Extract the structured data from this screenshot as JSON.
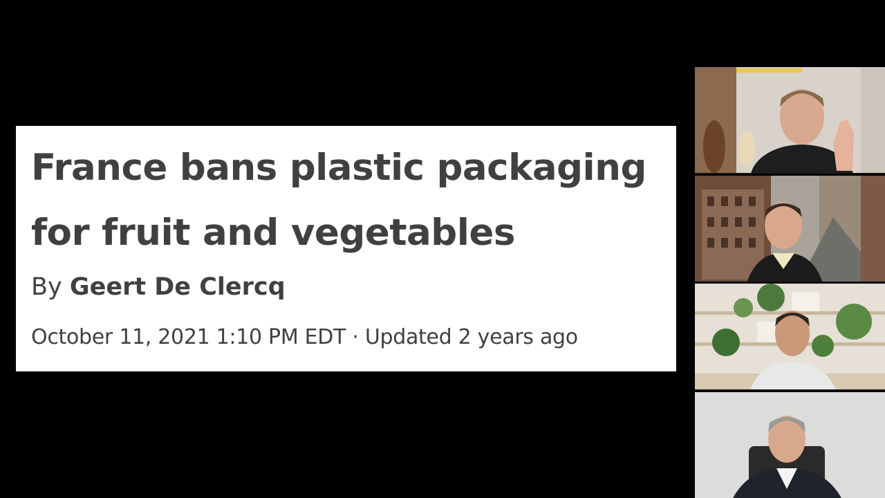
{
  "article": {
    "headline_line1": "France bans plastic packaging",
    "headline_line2": "for fruit and vegetables",
    "byline_prefix": "By",
    "author": "Geert De Clercq",
    "dateline": "October 11, 2021 1:10 PM EDT · Updated 2 years ago"
  },
  "participants": [
    {
      "tile": "participant-1",
      "background": "home studio with guitars"
    },
    {
      "tile": "participant-2",
      "background": "vintage city street"
    },
    {
      "tile": "participant-3",
      "background": "bookshelf with plants"
    },
    {
      "tile": "participant-4",
      "background": "plain office wall"
    }
  ]
}
